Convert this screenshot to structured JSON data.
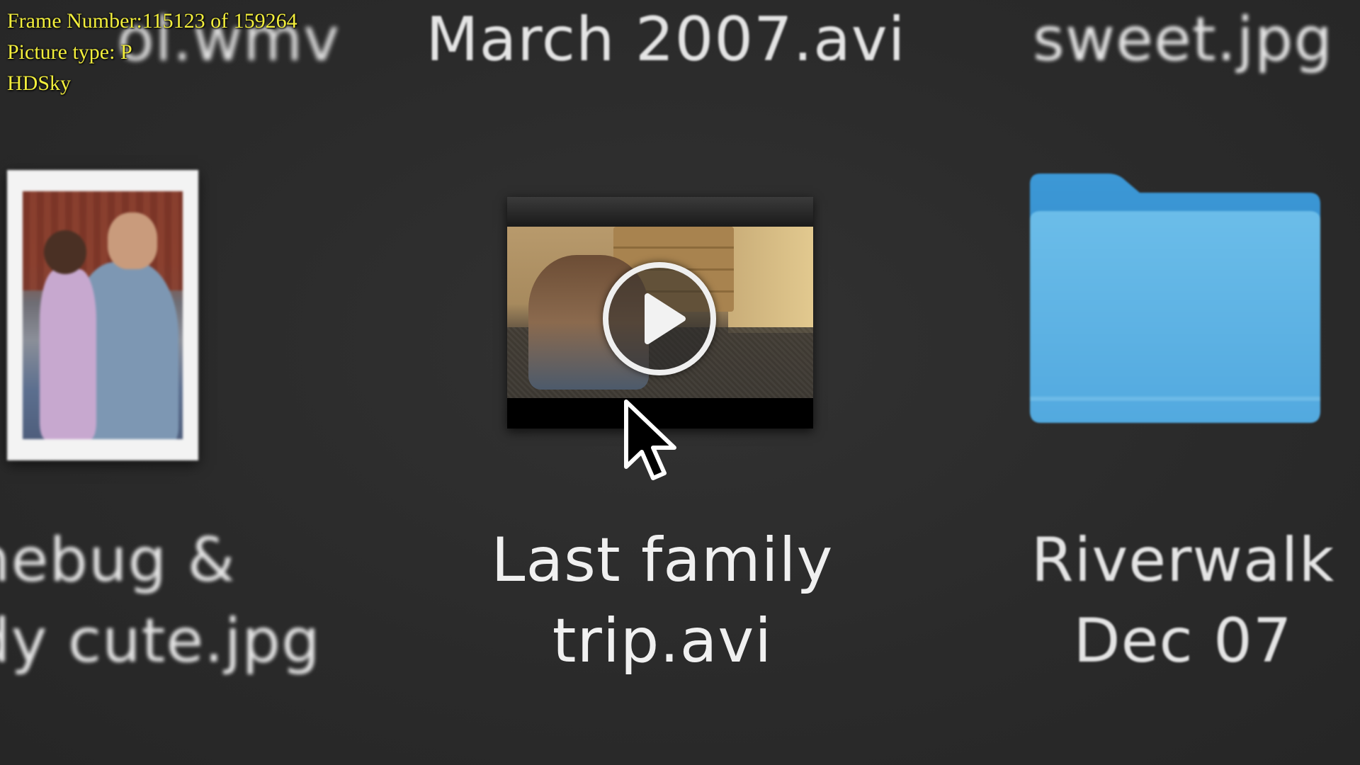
{
  "overlay": {
    "frame_number": "Frame Number:115123 of 159264",
    "picture_type": "Picture type: P",
    "site": "HDSky"
  },
  "files": {
    "top_row": [
      {
        "name": "ol.wmv"
      },
      {
        "name": "March 2007.avi"
      },
      {
        "name": "sweet.jpg"
      }
    ],
    "bottom_row": [
      {
        "line1": "nebug &",
        "line2": "dy cute.jpg",
        "kind": "photo"
      },
      {
        "line1": "Last family",
        "line2": "trip.avi",
        "kind": "video",
        "selected": true
      },
      {
        "line1": "Riverwalk",
        "line2": "Dec 07",
        "kind": "folder"
      }
    ]
  },
  "icons": {
    "photo": "photo-thumbnail-icon",
    "video": "video-thumbnail-icon",
    "play": "play-icon",
    "folder": "folder-icon",
    "cursor": "mouse-pointer-icon"
  },
  "colors": {
    "background": "#2b2b2b",
    "text": "#e4e4e4",
    "osd_text": "#f2ee3c",
    "folder_blue": "#4aa8df"
  }
}
